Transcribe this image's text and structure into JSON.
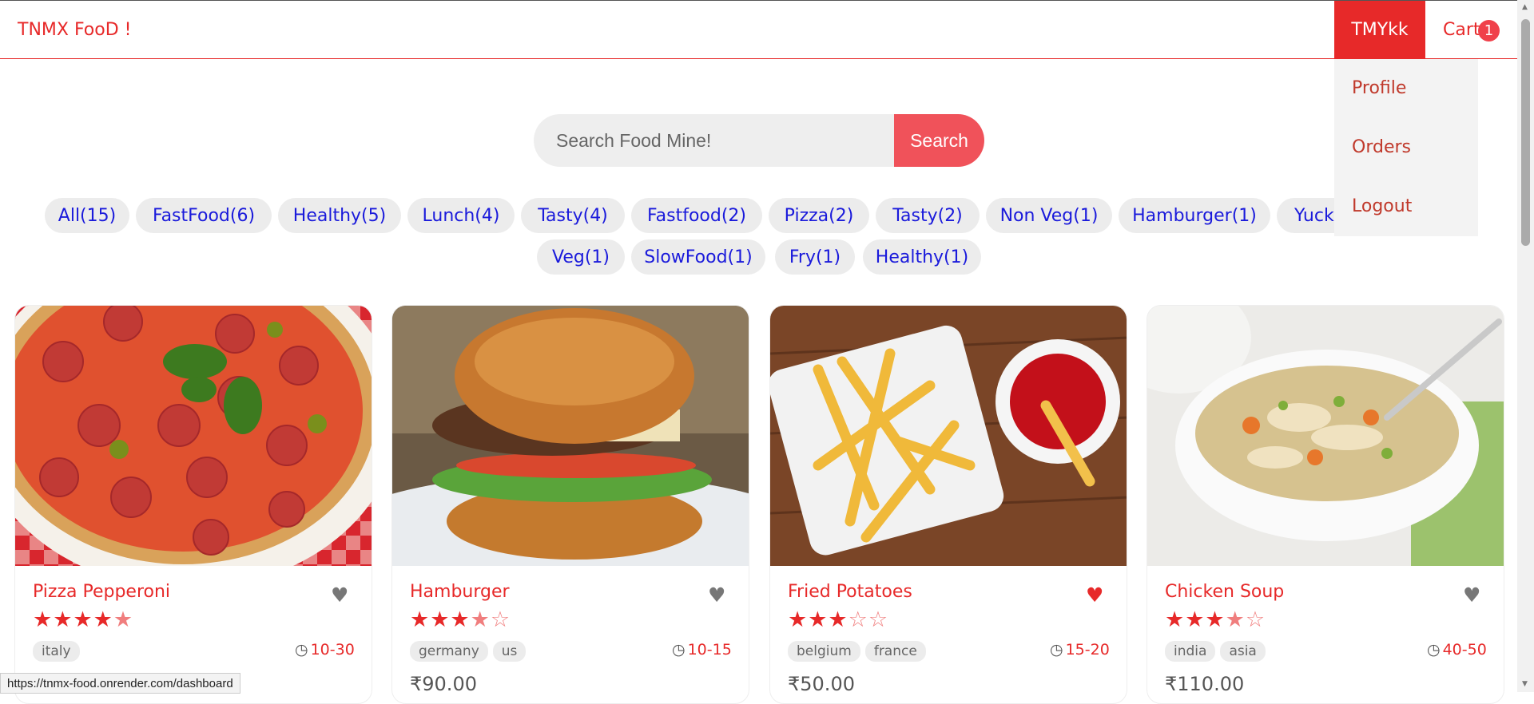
{
  "header": {
    "brand": "TNMX FooD !",
    "user_name": "TMYkk",
    "cart_label": "Cart",
    "cart_count": "1"
  },
  "user_menu": [
    "Profile",
    "Orders",
    "Logout"
  ],
  "search": {
    "placeholder": "Search Food Mine!",
    "button_label": "Search"
  },
  "tags": [
    "All(15)",
    "FastFood(6)",
    "Healthy(5)",
    "Lunch(4)",
    "Tasty(4)",
    "Fastfood(2)",
    "Pizza(2)",
    "Tasty(2)",
    "Non Veg(1)",
    "Hamburger(1)",
    "Yuck",
    "Veg(1)",
    "SlowFood(1)",
    "Fry(1)",
    "Healthy(1)"
  ],
  "foods": [
    {
      "name": "Pizza Pepperoni",
      "stars": 4.5,
      "favorite": false,
      "origins": [
        "italy"
      ],
      "time": "10-30",
      "price": "₹"
    },
    {
      "name": "Hamburger",
      "stars": 3.5,
      "favorite": false,
      "origins": [
        "germany",
        "us"
      ],
      "time": "10-15",
      "price": "₹90.00"
    },
    {
      "name": "Fried Potatoes",
      "stars": 3,
      "favorite": true,
      "origins": [
        "belgium",
        "france"
      ],
      "time": "15-20",
      "price": "₹50.00"
    },
    {
      "name": "Chicken Soup",
      "stars": 3.5,
      "favorite": false,
      "origins": [
        "india",
        "asia"
      ],
      "time": "40-50",
      "price": "₹110.00"
    }
  ],
  "status_url": "https://tnmx-food.onrender.com/dashboard",
  "colors": {
    "accent": "#e72929",
    "tag_text": "#1a1adb",
    "heart_off": "#777777"
  }
}
